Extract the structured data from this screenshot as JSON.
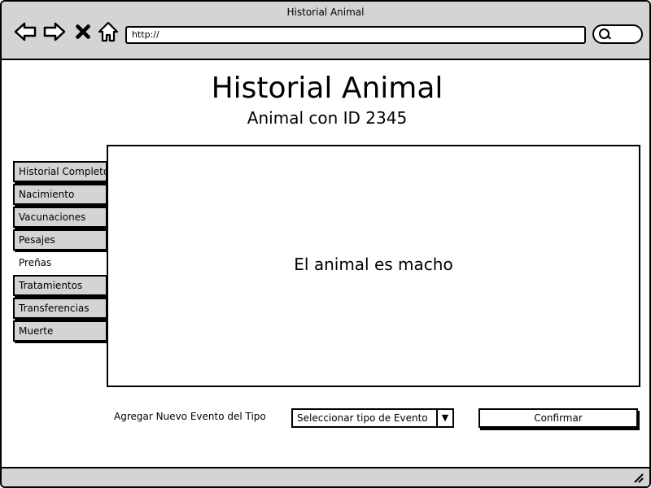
{
  "window": {
    "title": "Historial Animal",
    "url": "http://"
  },
  "header": {
    "title": "Historial Animal",
    "subtitle": "Animal con ID 2345"
  },
  "tabs": [
    {
      "label": "Historial Completo",
      "active": false
    },
    {
      "label": "Nacimiento",
      "active": false
    },
    {
      "label": "Vacunaciones",
      "active": false
    },
    {
      "label": "Pesajes",
      "active": false
    },
    {
      "label": "Preñas",
      "active": true
    },
    {
      "label": "Tratamientos",
      "active": false
    },
    {
      "label": "Transferencias",
      "active": false
    },
    {
      "label": "Muerte",
      "active": false
    }
  ],
  "content": {
    "message": "El animal es macho"
  },
  "footer_form": {
    "label": "Agregar Nuevo Evento del Tipo",
    "select_value": "Seleccionar tipo de Evento",
    "confirm_label": "Confirmar"
  },
  "colors": {
    "chrome": "#d4d4d4",
    "border": "#000000",
    "background": "#ffffff"
  },
  "icons": [
    "back-arrow-icon",
    "forward-arrow-icon",
    "close-icon",
    "home-icon",
    "search-icon",
    "resize-grip-icon",
    "dropdown-arrow-icon"
  ]
}
